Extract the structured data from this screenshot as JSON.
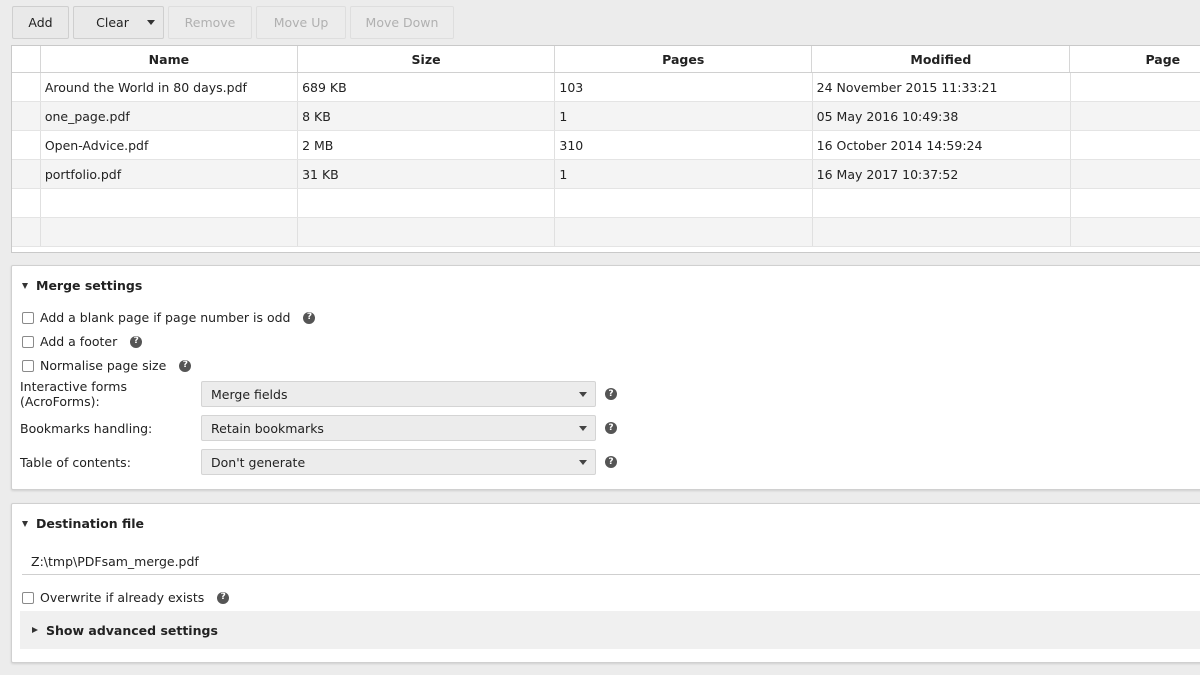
{
  "toolbar": {
    "add_label": "Add",
    "clear_label": "Clear",
    "remove_label": "Remove",
    "move_up_label": "Move Up",
    "move_down_label": "Move Down"
  },
  "table": {
    "columns": [
      "Name",
      "Size",
      "Pages",
      "Modified",
      "Page"
    ],
    "rows": [
      {
        "name": "Around the World in 80 days.pdf",
        "size": "689 KB",
        "pages": "103",
        "modified": "24 November 2015 11:33:21"
      },
      {
        "name": "one_page.pdf",
        "size": "8 KB",
        "pages": "1",
        "modified": "05 May 2016 10:49:38"
      },
      {
        "name": "Open-Advice.pdf",
        "size": "2 MB",
        "pages": "310",
        "modified": "16 October 2014 14:59:24"
      },
      {
        "name": "portfolio.pdf",
        "size": "31 KB",
        "pages": "1",
        "modified": "16 May 2017 10:37:52"
      }
    ]
  },
  "merge_settings": {
    "title": "Merge settings",
    "blank_page_label": "Add a blank page if page number is odd",
    "footer_label": "Add a footer",
    "normalise_label": "Normalise page size",
    "forms_label": "Interactive forms (AcroForms):",
    "forms_value": "Merge fields",
    "bookmarks_label": "Bookmarks handling:",
    "bookmarks_value": "Retain bookmarks",
    "toc_label": "Table of contents:",
    "toc_value": "Don't generate"
  },
  "destination": {
    "title": "Destination file",
    "path": "Z:\\tmp\\PDFsam_merge.pdf",
    "overwrite_label": "Overwrite if already exists",
    "advanced_label": "Show advanced settings"
  },
  "icons": {
    "help_glyph": "?"
  }
}
